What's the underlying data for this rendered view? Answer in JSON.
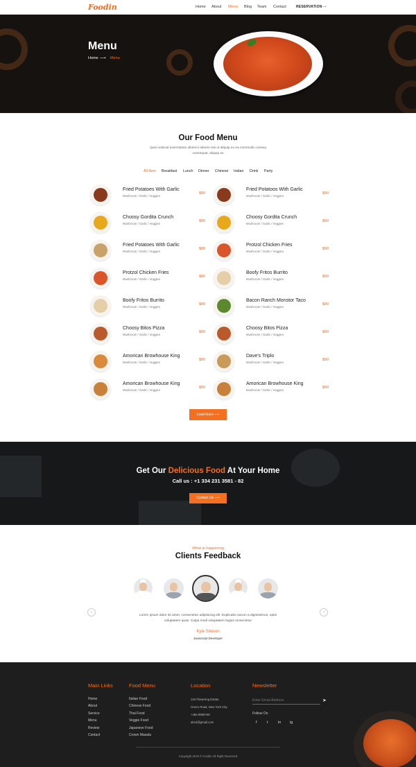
{
  "brand": {
    "logo": "Foodin",
    "accent": "#f36f21"
  },
  "nav": {
    "items": [
      "Home",
      "About",
      "Menu",
      "Blog",
      "Team",
      "Contact"
    ],
    "active": "Menu",
    "reservation": "RESERVATION"
  },
  "hero": {
    "title": "Menu",
    "crumb_home": "Home",
    "crumb_current": "Menu"
  },
  "menu": {
    "title": "Our Food Menu",
    "description": "Quis nostrud exercitation ullamco laboris nisi ut aliquip ex ea commodo conseq consequat, aliquip ex",
    "filters": [
      "All Item",
      "Breakfast",
      "Lunch",
      "Dinner",
      "Chinese",
      "Indian",
      "Drink",
      "Party"
    ],
    "active_filter": "All Item",
    "left": [
      {
        "name": "Fried Potatoes With Garlic",
        "sub": "Mushroom / Garlic / Veggies",
        "price": "$90"
      },
      {
        "name": "Choosy Gordita Crunch",
        "sub": "Mushroom / Garlic / Veggies",
        "price": "$90"
      },
      {
        "name": "Fried Potatoes With Garlic",
        "sub": "Mushroom / Garlic / Veggies",
        "price": "$88"
      },
      {
        "name": "Protzol Chicken Fries",
        "sub": "Mushroom / Garlic / Veggies",
        "price": "$80"
      },
      {
        "name": "Boofy Fritos Burrito",
        "sub": "Mushroom / Garlic / Veggies",
        "price": "$90"
      },
      {
        "name": "Choosy Bitos Pizza",
        "sub": "Mushroom / Garlic / Veggies",
        "price": "$90"
      },
      {
        "name": "Amorican Browhouse King",
        "sub": "Mushroom / Garlic / Veggies",
        "price": "$90"
      },
      {
        "name": "Amorican Browhouse King",
        "sub": "Mushroom / Garlic / Veggies",
        "price": "$90"
      }
    ],
    "right": [
      {
        "name": "Fried Potatoos With Garlic",
        "sub": "Mushroom / Garlic / Veggies",
        "price": "$90"
      },
      {
        "name": "Choosy Gordita Crunch",
        "sub": "Mushroom / Garlic / Veggies",
        "price": "$90"
      },
      {
        "name": "Protzol Chicken Fries",
        "sub": "Mushroom / Garlic / Veggies",
        "price": "$90"
      },
      {
        "name": "Boofy Fritos Burrito",
        "sub": "Mushroom / Garlic / Veggies",
        "price": "$90"
      },
      {
        "name": "Bacon Ranch Monstor Taco",
        "sub": "Mushroom / Garlic / Veggies",
        "price": "$90"
      },
      {
        "name": "Choosy Bitos Pizza",
        "sub": "Mushroom / Garlic / Veggies",
        "price": "$90"
      },
      {
        "name": "Dave's Triplo",
        "sub": "Mushroom / Garlic / Veggies",
        "price": "$90"
      },
      {
        "name": "Amorican Browhouse King",
        "sub": "Mushroom / Garlic / Veggies",
        "price": "$90"
      }
    ],
    "load_more": "Load More"
  },
  "delivery": {
    "title_pre": "Get Our",
    "title_hl": "Delicious Food",
    "title_post": "At Your Home",
    "call": "Call us : +1 334 231 3581 - 82",
    "button": "Contact Us"
  },
  "feedback": {
    "kicker": "What is happening",
    "title": "Clients Feedback",
    "quote": "Lorem ipsum dolor sit amet, consectetur adipisicing elit. Explicabo earum a dignissimos, optio voluptatem quas. Culpa modi voluptatem fugiat consectetur",
    "name": "Kyle Simson",
    "role": "Javascript Developer"
  },
  "footer": {
    "main_links": {
      "title": "Main Links",
      "items": [
        "Home",
        "About",
        "Service",
        "Menu",
        "Review",
        "Contact"
      ]
    },
    "food_menu": {
      "title": "Food Menu",
      "items": [
        "Italian Food",
        "Chinese Food",
        "Thai Food",
        "Veggie Food",
        "Japanese Food",
        "Crown Masala"
      ]
    },
    "location": {
      "title": "Location",
      "lines": [
        "134 Flowering Estate,",
        "Green Road, New York City.",
        "+456 8965768",
        "abcd@gmail.com"
      ]
    },
    "newsletter": {
      "title": "Newsletter",
      "placeholder": "Enter Email Address",
      "follow": "Follow On"
    },
    "social": [
      "f",
      "t",
      "in",
      "ig"
    ],
    "copyright": "Copyright 2019 © Foodin All Right Reserved"
  }
}
